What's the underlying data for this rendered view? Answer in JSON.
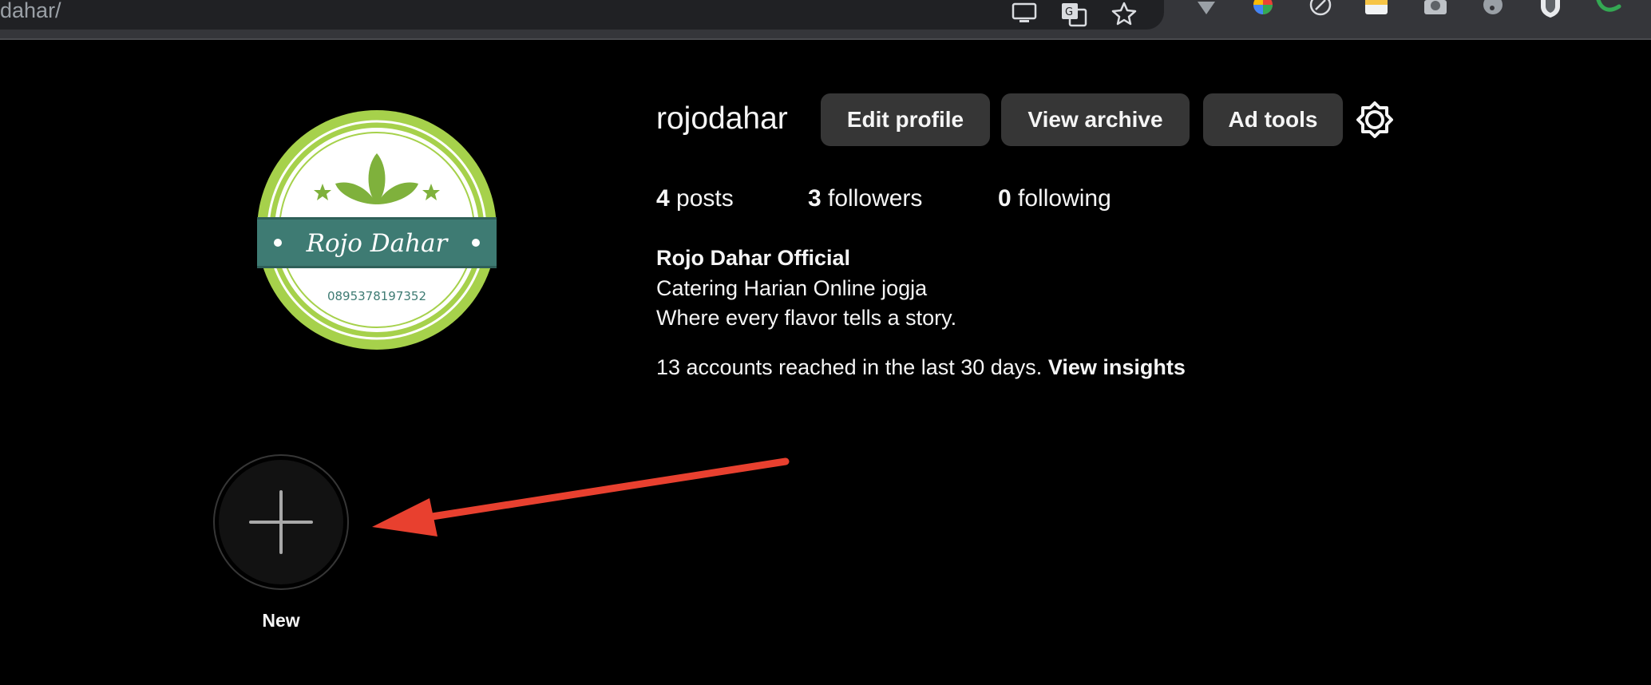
{
  "browser": {
    "url_fragment": "dahar/",
    "icons": [
      "cast-icon",
      "translate-icon",
      "bookmark-star-icon",
      "extension-vpn-icon",
      "extension-color-icon",
      "extension-compass-icon",
      "extension-notes-icon",
      "extension-camera-icon",
      "extension-music-icon",
      "extension-shield-icon",
      "extension-leaf-icon"
    ]
  },
  "profile": {
    "username": "rojodahar",
    "buttons": {
      "edit": "Edit profile",
      "archive": "View archive",
      "ad_tools": "Ad tools"
    },
    "stats": {
      "posts_count": "4",
      "posts_label": "posts",
      "followers_count": "3",
      "followers_label": "followers",
      "following_count": "0",
      "following_label": "following"
    },
    "bio": {
      "name": "Rojo Dahar Official",
      "line1": "Catering Harian Online jogja",
      "line2": "Where every flavor tells a story."
    },
    "insights": {
      "text": "13 accounts reached in the last 30 days.",
      "link": "View insights"
    }
  },
  "avatar": {
    "brand": "Rojo Dahar",
    "phone": "0895378197352",
    "colors": {
      "ring": "#a6d14b",
      "band": "#3e7b73",
      "leaf": "#7fb13c"
    }
  },
  "highlights": {
    "new_label": "New"
  },
  "annotation": {
    "arrow_color": "#e8402f"
  }
}
